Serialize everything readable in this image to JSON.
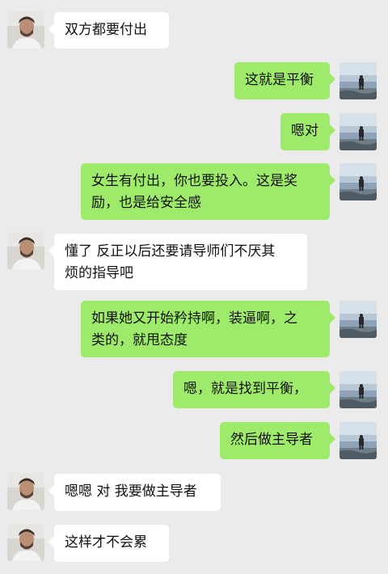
{
  "colors": {
    "background": "#ebebeb",
    "incoming_bubble": "#ffffff",
    "outgoing_bubble": "#9eea6a"
  },
  "contact_avatar_icon": "bearded-man-photo",
  "self_avatar_icon": "person-on-beach-photo",
  "messages": [
    {
      "side": "incoming",
      "text": "双方都要付出"
    },
    {
      "side": "outgoing",
      "text": "这就是平衡"
    },
    {
      "side": "outgoing",
      "text": "嗯对"
    },
    {
      "side": "outgoing",
      "text": "女生有付出，你也要投入。这是奖\n励，也是给安全感"
    },
    {
      "side": "incoming",
      "text": "懂了 反正以后还要请导师们不厌其\n烦的指导吧"
    },
    {
      "side": "outgoing",
      "text": "如果她又开始矜持啊，装逼啊，之\n类的，就甩态度"
    },
    {
      "side": "outgoing",
      "text": "嗯，就是找到平衡，"
    },
    {
      "side": "outgoing",
      "text": "然后做主导者"
    },
    {
      "side": "incoming",
      "text": "嗯嗯 对 我要做主导者"
    },
    {
      "side": "incoming",
      "text": "这样才不会累"
    }
  ]
}
